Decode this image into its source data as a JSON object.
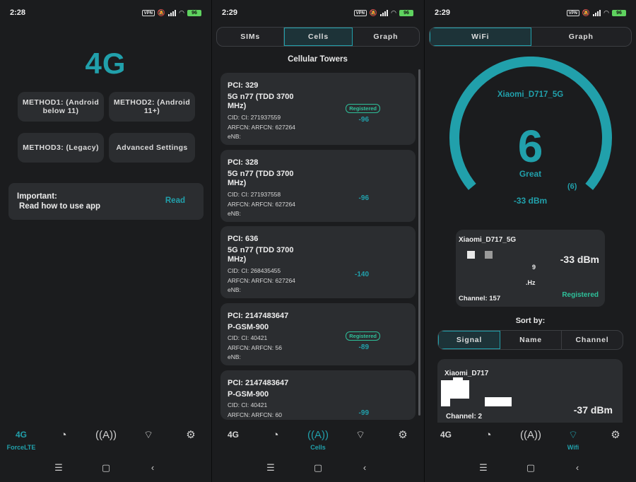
{
  "colors": {
    "accent": "#21a0ab",
    "registered": "#2ec09a",
    "card": "#2b2d30",
    "bg": "#1b1c1e"
  },
  "status_bar": {
    "time1": "2:28",
    "time2": "2:29",
    "time3": "2:29",
    "vpn": "VPN",
    "net": "5G",
    "battery": "96"
  },
  "screen1": {
    "logo": "4G",
    "method1": "METHOD1: (Android below 11)",
    "method2": "METHOD2: (Android 11+)",
    "method3": "METHOD3: (Legacy)",
    "advanced": "Advanced Settings",
    "important_title": "Important:",
    "important_text": "Read how to use app",
    "read_link": "Read"
  },
  "nav": {
    "label_4g": "4G",
    "forcelte": "ForceLTE",
    "cells": "Cells",
    "wifi": "Wifi",
    "icons": [
      "4g-icon",
      "speedometer-icon",
      "cell-tower-icon",
      "wifi-icon",
      "settings-icon"
    ]
  },
  "screen2": {
    "tabs": [
      "SIMs",
      "Cells",
      "Graph"
    ],
    "title": "Cellular Towers",
    "cells": [
      {
        "pci": "PCI: 329",
        "band": "5G n77 (TDD 3700 MHz)",
        "cid": "CID: CI: 271937559",
        "arfcn": "ARFCN: ARFCN: 627264",
        "enb": "eNB:",
        "value": "-96",
        "registered": "Registered"
      },
      {
        "pci": "PCI: 328",
        "band": "5G n77 (TDD 3700 MHz)",
        "cid": "CID: CI: 271937558",
        "arfcn": "ARFCN: ARFCN: 627264",
        "enb": "eNB:",
        "value": "-96",
        "registered": ""
      },
      {
        "pci": "PCI: 636",
        "band": "5G n77 (TDD 3700 MHz)",
        "cid": "CID: CI: 268435455",
        "arfcn": "ARFCN: ARFCN: 627264",
        "enb": "eNB:",
        "value": "-140",
        "registered": ""
      },
      {
        "pci": "PCI: 2147483647",
        "band": "P-GSM-900",
        "cid": "CID: CI: 40421",
        "arfcn": "ARFCN: ARFCN: 56",
        "enb": "eNB:",
        "value": "-89",
        "registered": "Registered"
      },
      {
        "pci": "PCI: 2147483647",
        "band": "P-GSM-900",
        "cid": "CID: CI: 40421",
        "arfcn": "ARFCN: ARFCN: 60",
        "enb": "",
        "value": "-99",
        "registered": ""
      }
    ]
  },
  "screen3": {
    "tabs": [
      "WiFi",
      "Graph"
    ],
    "gauge": {
      "ssid": "Xiaomi_D717_5G",
      "score": "6",
      "quality": "Great",
      "count": "(6)",
      "dbm": "-33 dBm",
      "level": 0.6
    },
    "card": {
      "ssid": "Xiaomi_D717_5G",
      "dbm": "-33 dBm",
      "num": "9",
      "hz": ".Hz",
      "channel": "Channel: 157",
      "status": "Registered"
    },
    "sort_by": "Sort by:",
    "sort_tabs": [
      "Signal",
      "Name",
      "Channel"
    ],
    "card2": {
      "ssid": "Xiaomi_D717",
      "channel": "Channel: 2",
      "dbm": "-37 dBm"
    }
  }
}
